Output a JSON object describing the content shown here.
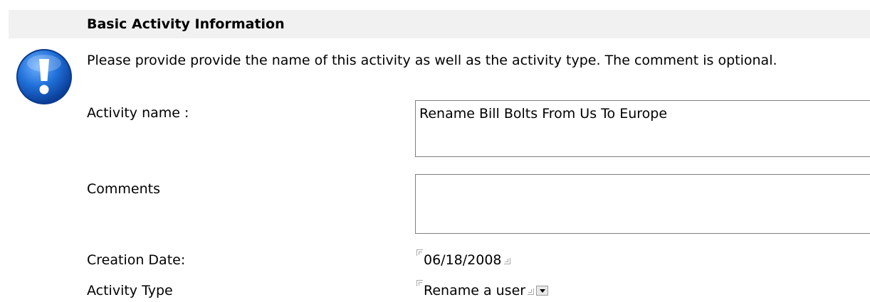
{
  "section": {
    "title": "Basic Activity Information",
    "instructions": "Please provide provide the name of this activity as well as the activity type.  The comment is optional."
  },
  "form": {
    "activity_name": {
      "label": "Activity name :",
      "value": "Rename Bill Bolts From Us To Europe"
    },
    "comments": {
      "label": "Comments",
      "value": ""
    },
    "creation_date": {
      "label": "Creation Date:",
      "value": "06/18/2008"
    },
    "activity_type": {
      "label": "Activity Type",
      "selected": "Rename a user"
    }
  },
  "icons": {
    "info": "exclamation-info-icon",
    "dropdown": "chevron-down-icon"
  },
  "colors": {
    "header_background": "#f1f1f1",
    "icon_blue": "#1a63c6"
  }
}
